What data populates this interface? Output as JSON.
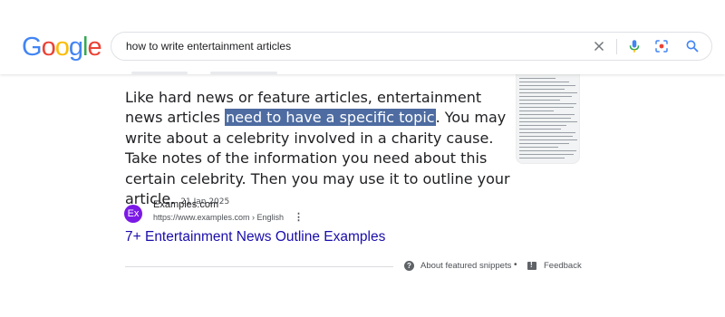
{
  "header": {
    "logo_letters": [
      {
        "ch": "G",
        "color": "#4285f4"
      },
      {
        "ch": "o",
        "color": "#ea4335"
      },
      {
        "ch": "o",
        "color": "#fbbc05"
      },
      {
        "ch": "g",
        "color": "#4285f4"
      },
      {
        "ch": "l",
        "color": "#34a853"
      },
      {
        "ch": "e",
        "color": "#ea4335"
      }
    ],
    "search_query": "how to write entertainment articles",
    "icons": [
      "close-icon",
      "mic-icon",
      "lens-icon",
      "search-icon"
    ]
  },
  "snippet": {
    "text_before": "Like hard news or feature articles, entertainment news articles ",
    "highlight": "need to have a specific topic",
    "text_after": ". You may write about a celebrity involved in a charity cause. Take notes of the information you need about this certain celebrity. Then you may use it to outline your article.",
    "date": "21 Jan 2025"
  },
  "source": {
    "favicon_text": "Ex",
    "favicon_color": "#7b19e6",
    "site_name": "Examples.com",
    "url": "https://www.examples.com › English",
    "more_icon": "⋮",
    "title": "7+ Entertainment News Outline Examples"
  },
  "footer": {
    "about": "About featured snippets",
    "separator": "•",
    "feedback": "Feedback"
  },
  "colors": {
    "link": "#1a0dab",
    "highlight_bg": "#4e6ca1"
  }
}
